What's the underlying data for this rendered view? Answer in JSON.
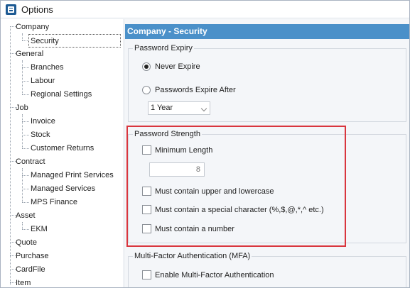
{
  "window": {
    "title": "Options"
  },
  "tree": [
    {
      "label": "Company",
      "level": 0
    },
    {
      "label": "Security",
      "level": 1,
      "selected": true
    },
    {
      "label": "General",
      "level": 0
    },
    {
      "label": "Branches",
      "level": 1
    },
    {
      "label": "Labour",
      "level": 1
    },
    {
      "label": "Regional Settings",
      "level": 1
    },
    {
      "label": "Job",
      "level": 0
    },
    {
      "label": "Invoice",
      "level": 1
    },
    {
      "label": "Stock",
      "level": 1
    },
    {
      "label": "Customer Returns",
      "level": 1
    },
    {
      "label": "Contract",
      "level": 0
    },
    {
      "label": "Managed Print Services",
      "level": 1
    },
    {
      "label": "Managed Services",
      "level": 1
    },
    {
      "label": "MPS Finance",
      "level": 1
    },
    {
      "label": "Asset",
      "level": 0
    },
    {
      "label": "EKM",
      "level": 1
    },
    {
      "label": "Quote",
      "level": 0
    },
    {
      "label": "Purchase",
      "level": 0
    },
    {
      "label": "CardFile",
      "level": 0
    },
    {
      "label": "Item",
      "level": 0
    }
  ],
  "main": {
    "header": "Company - Security",
    "password_expiry": {
      "title": "Password Expiry",
      "never_expire": "Never Expire",
      "expire_after": "Passwords Expire After",
      "period_value": "1 Year"
    },
    "password_strength": {
      "title": "Password Strength",
      "min_length": "Minimum Length",
      "min_length_value": "8",
      "upper_lower": "Must contain upper and lowercase",
      "special_char": "Must contain a special character (%,$,@,*,^ etc.)",
      "number": "Must contain a number"
    },
    "mfa": {
      "title": "Multi-Factor Authentication (MFA)",
      "enable": "Enable Multi-Factor Authentication"
    }
  },
  "colors": {
    "header_bar": "#4a90c9",
    "highlight_border": "#d9363e"
  }
}
